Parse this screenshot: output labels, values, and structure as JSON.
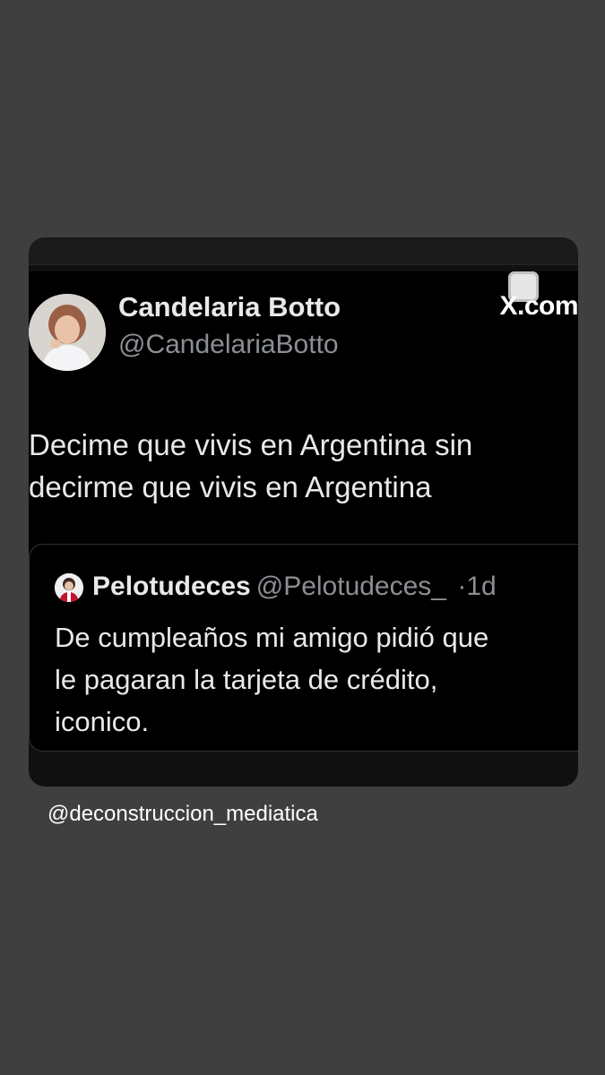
{
  "tweet": {
    "author_name": "Candelaria Botto",
    "author_handle": "@CandelariaBotto",
    "source_logo": "X.com",
    "text": "Decime que vivis en Argentina sin\ndecirme que vivis en Argentina",
    "quoted": {
      "name": "Pelotudeces",
      "handle": "@Pelotudeces_",
      "separator": "·",
      "time": "1d",
      "text": "De cumpleaños mi amigo pidió que\nle pagaran la tarjeta de crédito,\niconico."
    }
  },
  "watermark": "@deconstruccion_mediatica",
  "colors": {
    "background": "#3f3f3f",
    "card": "#101010",
    "tweet_bg": "#000000",
    "text_primary": "#e7e9ea",
    "text_secondary": "#8b8f94"
  }
}
